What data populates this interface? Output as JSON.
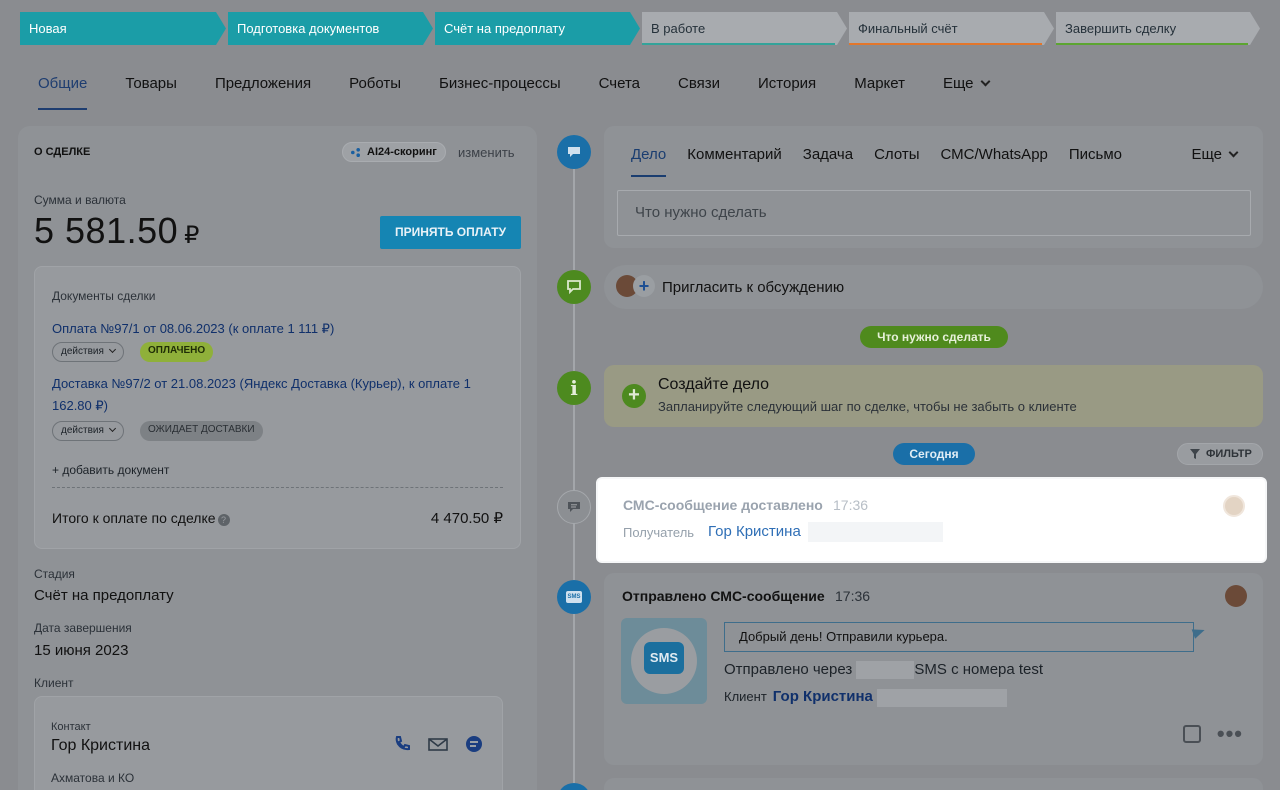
{
  "stages": [
    {
      "label": "Новая",
      "state": "active"
    },
    {
      "label": "Подготовка документов",
      "state": "active"
    },
    {
      "label": "Счёт на предоплату",
      "state": "active"
    },
    {
      "label": "В работе",
      "state": "inactive",
      "bar": "#34a39a"
    },
    {
      "label": "Финальный счёт",
      "state": "inactive",
      "bar": "#e2762b"
    },
    {
      "label": "Завершить сделку",
      "state": "inactive",
      "bar": "#5ca531"
    }
  ],
  "tabs": [
    "Общие",
    "Товары",
    "Предложения",
    "Роботы",
    "Бизнес-процессы",
    "Счета",
    "Связи",
    "История",
    "Маркет",
    "Еще"
  ],
  "deal": {
    "header": "О СДЕЛКЕ",
    "ai_badge": "AI24-скоринг",
    "change": "изменить",
    "sum_label": "Сумма и валюта",
    "sum": "5 581.50",
    "currency": "₽",
    "pay_button": "ПРИНЯТЬ ОПЛАТУ",
    "docs": {
      "title": "Документы сделки",
      "items": [
        {
          "link": "Оплата №97/1 от 08.06.2023 (к оплате 1 111 ₽)",
          "actions": "действия",
          "status": "ОПЛАЧЕНО"
        },
        {
          "link": "Доставка №97/2 от 21.08.2023 (Яндекс Доставка (Курьер), к оплате 1 162.80 ₽)",
          "actions": "действия",
          "status": "ОЖИДАЕТ ДОСТАВКИ"
        }
      ],
      "add": "+ добавить документ",
      "total_label": "Итого к оплате по сделке",
      "total_value": "4 470.50 ₽"
    },
    "stage_label": "Стадия",
    "stage_value": "Счёт на предоплату",
    "date_label": "Дата завершения",
    "date_value": "15 июня 2023",
    "client_label": "Клиент",
    "contact_label": "Контакт",
    "contact_name": "Гор Кристина",
    "company": "Ахматова и КО"
  },
  "editor": {
    "tabs": [
      "Дело",
      "Комментарий",
      "Задача",
      "Слоты",
      "СМС/WhatsApp",
      "Письмо"
    ],
    "more": "Еще",
    "placeholder": "Что нужно сделать"
  },
  "invite": "Пригласить к обсуждению",
  "todo_chip": "Что нужно сделать",
  "create": {
    "title": "Создайте дело",
    "subtitle": "Запланируйте следующий шаг по сделке, чтобы не забыть о клиенте"
  },
  "today_chip": "Сегодня",
  "filter": "ФИЛЬТР",
  "sms_delivered": {
    "title": "СМС-сообщение доставлено",
    "time": "17:36",
    "recipient_label": "Получатель",
    "recipient": "Гор Кристина"
  },
  "sms_sent": {
    "title": "Отправлено СМС-сообщение",
    "time": "17:36",
    "message": "Добрый день! Отправили курьера.",
    "via_prefix": "Отправлено через",
    "via_suffix": "SMS с номера test",
    "client_label": "Клиент",
    "client": "Гор Кристина",
    "sms_icon": "SMS"
  }
}
